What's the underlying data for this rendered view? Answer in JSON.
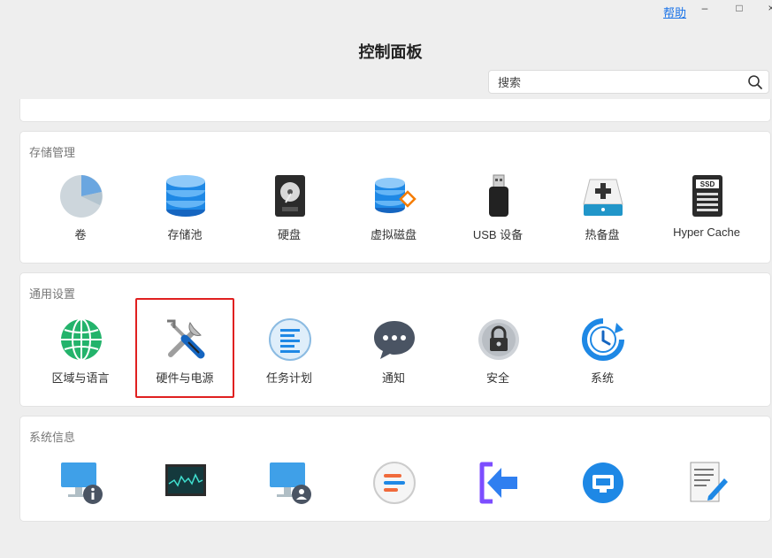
{
  "window": {
    "help_label": "帮助",
    "minimize_symbol": "–",
    "maximize_symbol": "□",
    "close_symbol": "×",
    "title": "控制面板"
  },
  "search": {
    "placeholder": "搜索",
    "value": ""
  },
  "sections": {
    "storage": {
      "title": "存储管理",
      "items": [
        {
          "label": "卷",
          "icon": "volume-pie-icon"
        },
        {
          "label": "存储池",
          "icon": "storage-pool-icon"
        },
        {
          "label": "硬盘",
          "icon": "hard-disk-icon"
        },
        {
          "label": "虚拟磁盘",
          "icon": "virtual-disk-icon"
        },
        {
          "label": "USB 设备",
          "icon": "usb-icon"
        },
        {
          "label": "热备盘",
          "icon": "hot-spare-icon"
        },
        {
          "label": "Hyper Cache",
          "icon": "ssd-icon"
        }
      ]
    },
    "general": {
      "title": "通用设置",
      "items": [
        {
          "label": "区域与语言",
          "icon": "globe-icon"
        },
        {
          "label": "硬件与电源",
          "icon": "tools-icon"
        },
        {
          "label": "任务计划",
          "icon": "task-list-icon"
        },
        {
          "label": "通知",
          "icon": "chat-bubble-icon"
        },
        {
          "label": "安全",
          "icon": "lock-icon"
        },
        {
          "label": "系统",
          "icon": "clock-refresh-icon"
        }
      ]
    },
    "sysinfo": {
      "title": "系统信息",
      "items": [
        {
          "icon": "monitor-info-icon"
        },
        {
          "icon": "resource-monitor-icon"
        },
        {
          "icon": "monitor-user-icon"
        },
        {
          "icon": "log-icon"
        },
        {
          "icon": "login-arrow-icon"
        },
        {
          "icon": "network-icon"
        },
        {
          "icon": "document-edit-icon"
        }
      ]
    }
  },
  "colors": {
    "highlight": "#e02020",
    "link": "#1a73e8",
    "accent": "#1e88e5"
  }
}
